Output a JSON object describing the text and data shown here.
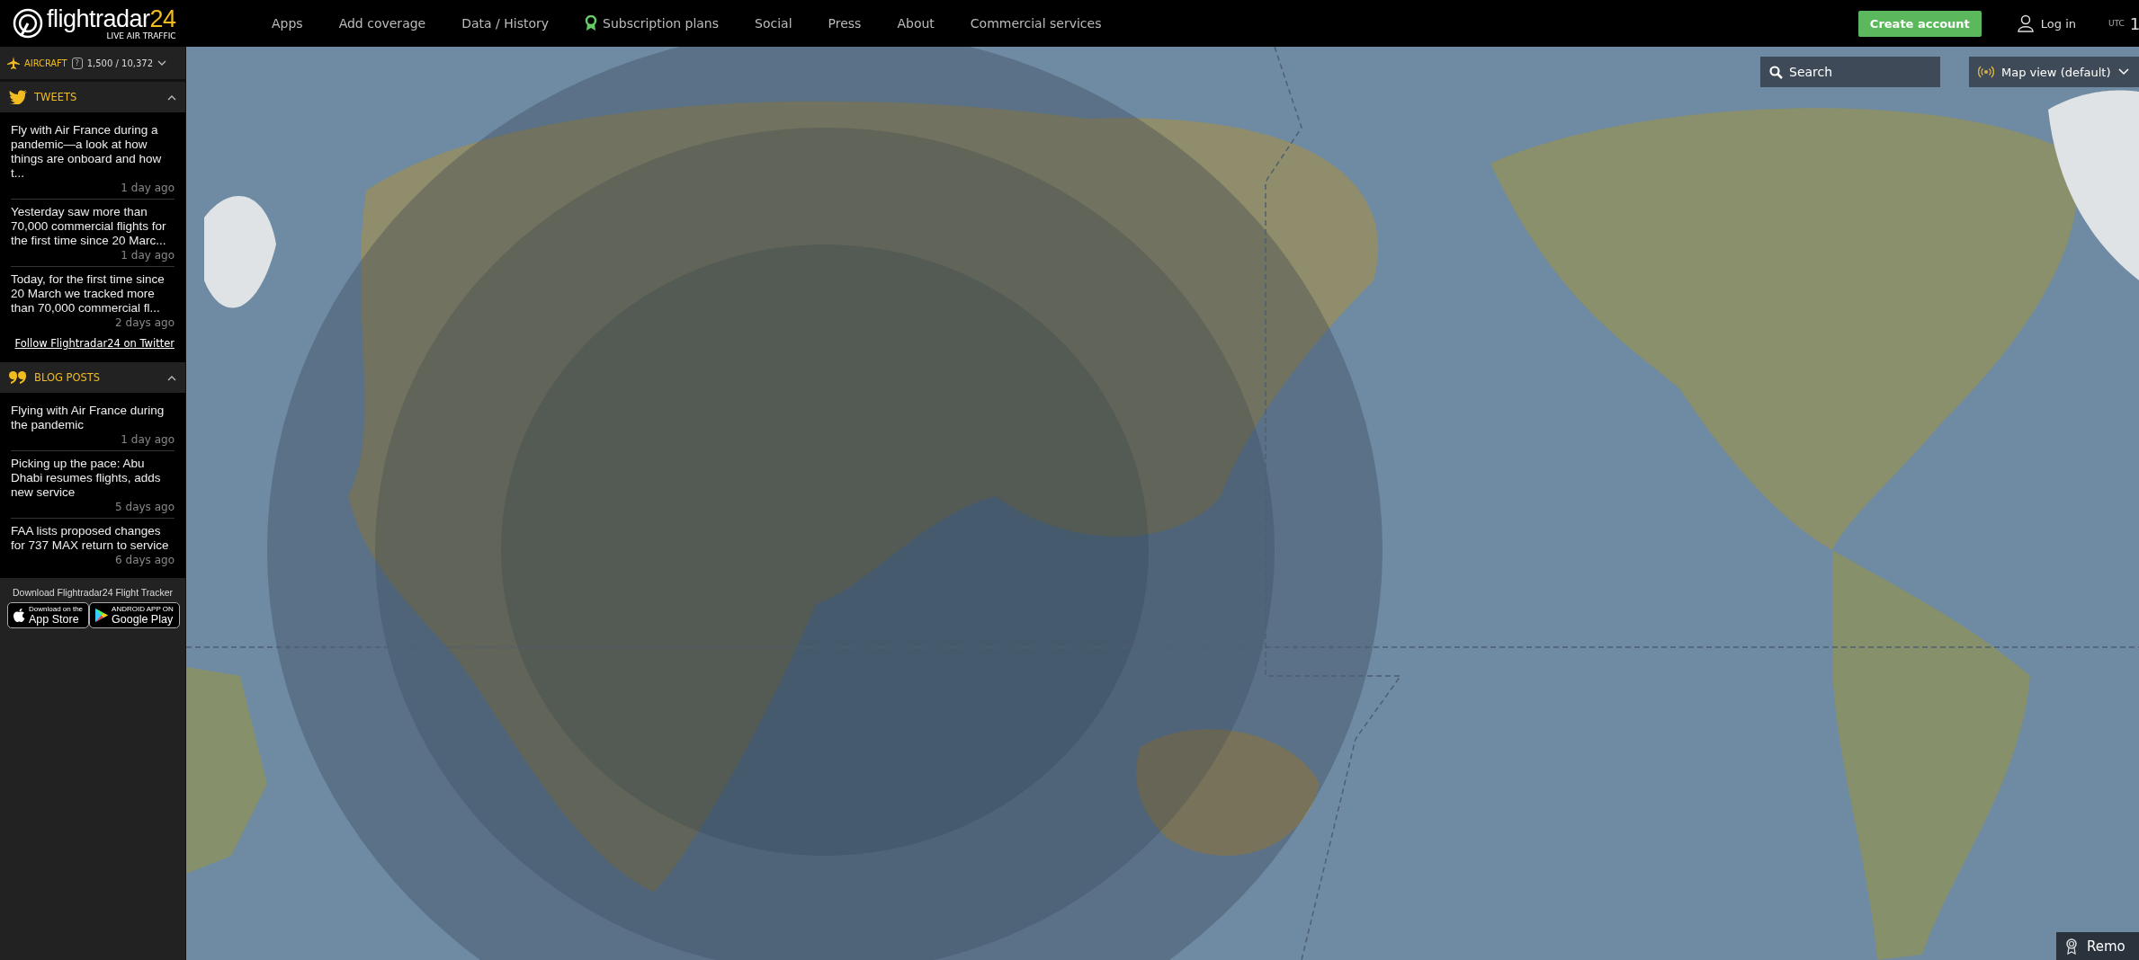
{
  "header": {
    "logo": "flightradar24",
    "tagline": "LIVE AIR TRAFFIC",
    "nav": [
      {
        "label": "Apps",
        "badge": false
      },
      {
        "label": "Add coverage",
        "badge": false
      },
      {
        "label": "Data / History",
        "badge": false
      },
      {
        "label": "Subscription plans",
        "badge": true
      },
      {
        "label": "Social",
        "badge": false
      },
      {
        "label": "Press",
        "badge": false
      },
      {
        "label": "About",
        "badge": false
      },
      {
        "label": "Commercial services",
        "badge": false
      }
    ],
    "create_account": "Create account",
    "login": "Log in",
    "utc_label": "UTC",
    "utc_time": "1"
  },
  "sidebar": {
    "aircraft": {
      "label": "AIRCRAFT",
      "help": "?",
      "count": "1,500 / 10,372",
      "expanded": false
    },
    "sections": [
      {
        "kind": "tweets",
        "title": "TWEETS",
        "expanded": true,
        "items": [
          {
            "text": "Fly with Air France during a pandemic—a look at how things are onboard and how t...",
            "time": "1 day ago"
          },
          {
            "text": "Yesterday saw more than 70,000 commercial flights for the first time since 20 Marc...",
            "time": "1 day ago"
          },
          {
            "text": "Today, for the first time since 20 March we tracked more than 70,000 commercial fl...",
            "time": "2 days ago"
          }
        ],
        "link": "Follow Flightradar24 on Twitter"
      },
      {
        "kind": "blog",
        "title": "BLOG POSTS",
        "expanded": true,
        "items": [
          {
            "text": "Flying with Air France during the pandemic",
            "time": "1 day ago"
          },
          {
            "text": "Picking up the pace: Abu Dhabi resumes flights, adds new service",
            "time": "5 days ago"
          },
          {
            "text": "FAA lists proposed changes for 737 MAX return to service",
            "time": "6 days ago"
          }
        ]
      }
    ],
    "download": {
      "title": "Download Flightradar24 Flight Tracker",
      "stores": [
        {
          "kind": "apple",
          "small": "Download on the",
          "big": "App Store"
        },
        {
          "kind": "google",
          "small": "ANDROID APP ON",
          "big": "Google Play"
        }
      ]
    }
  },
  "map": {
    "kind": "picture",
    "search": {
      "placeholder": "Search"
    },
    "view": "Map view (default)",
    "remove_ads": "Remo"
  }
}
